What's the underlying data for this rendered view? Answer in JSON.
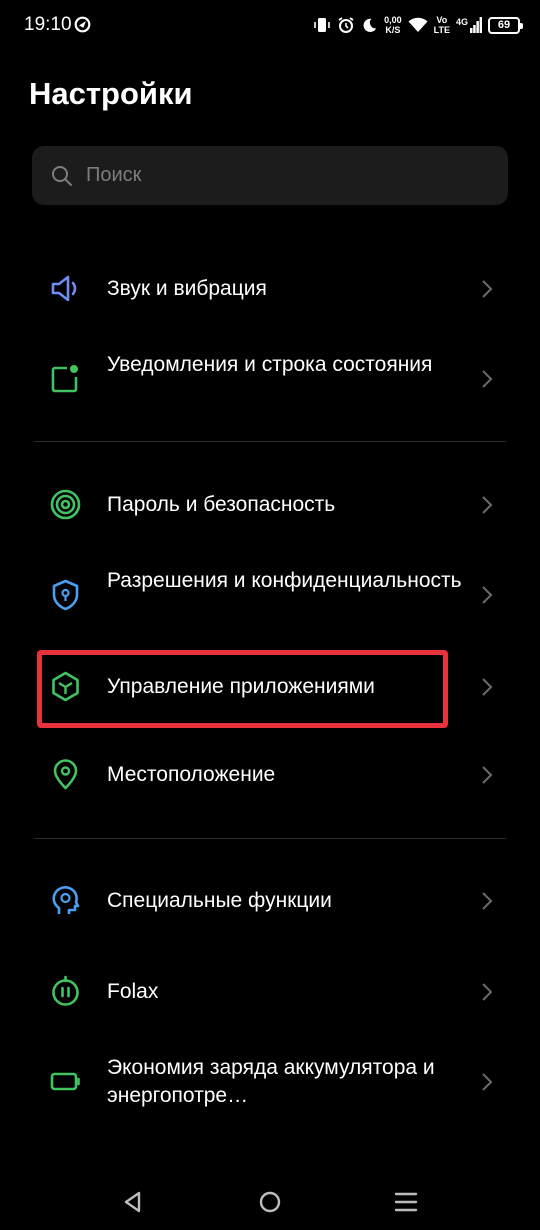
{
  "status_bar": {
    "time": "19:10",
    "net_speed_value": "0,00",
    "net_speed_unit": "K/S",
    "network_top": "Vo",
    "network_bottom": "LTE",
    "signal_type": "4G",
    "battery_level": "69",
    "icons": [
      "vpn-icon",
      "vibrate-icon",
      "alarm-icon",
      "moon-icon",
      "wifi-icon",
      "signal-icon",
      "battery-icon"
    ]
  },
  "header": {
    "title": "Настройки"
  },
  "search": {
    "placeholder": "Поиск"
  },
  "settings": {
    "items": [
      {
        "label": "Звук и вибрация",
        "icon": "speaker-icon"
      },
      {
        "label": "Уведомления и строка состояния",
        "icon": "notification-icon"
      },
      {
        "label": "Пароль и безопасность",
        "icon": "fingerprint-icon"
      },
      {
        "label": "Разрешения и конфиденциальность",
        "icon": "shield-lock-icon"
      },
      {
        "label": "Управление приложениями",
        "icon": "app-cube-icon"
      },
      {
        "label": "Местоположение",
        "icon": "location-pin-icon"
      },
      {
        "label": "Специальные функции",
        "icon": "accessibility-head-icon"
      },
      {
        "label": "Folax",
        "icon": "folax-icon"
      },
      {
        "label": "Экономия заряда аккумулятора и энергопотре…",
        "icon": "battery-saver-icon"
      }
    ]
  },
  "highlight_color": "#e8323c",
  "nav": {
    "buttons": [
      "back-icon",
      "home-icon",
      "recents-icon"
    ]
  }
}
